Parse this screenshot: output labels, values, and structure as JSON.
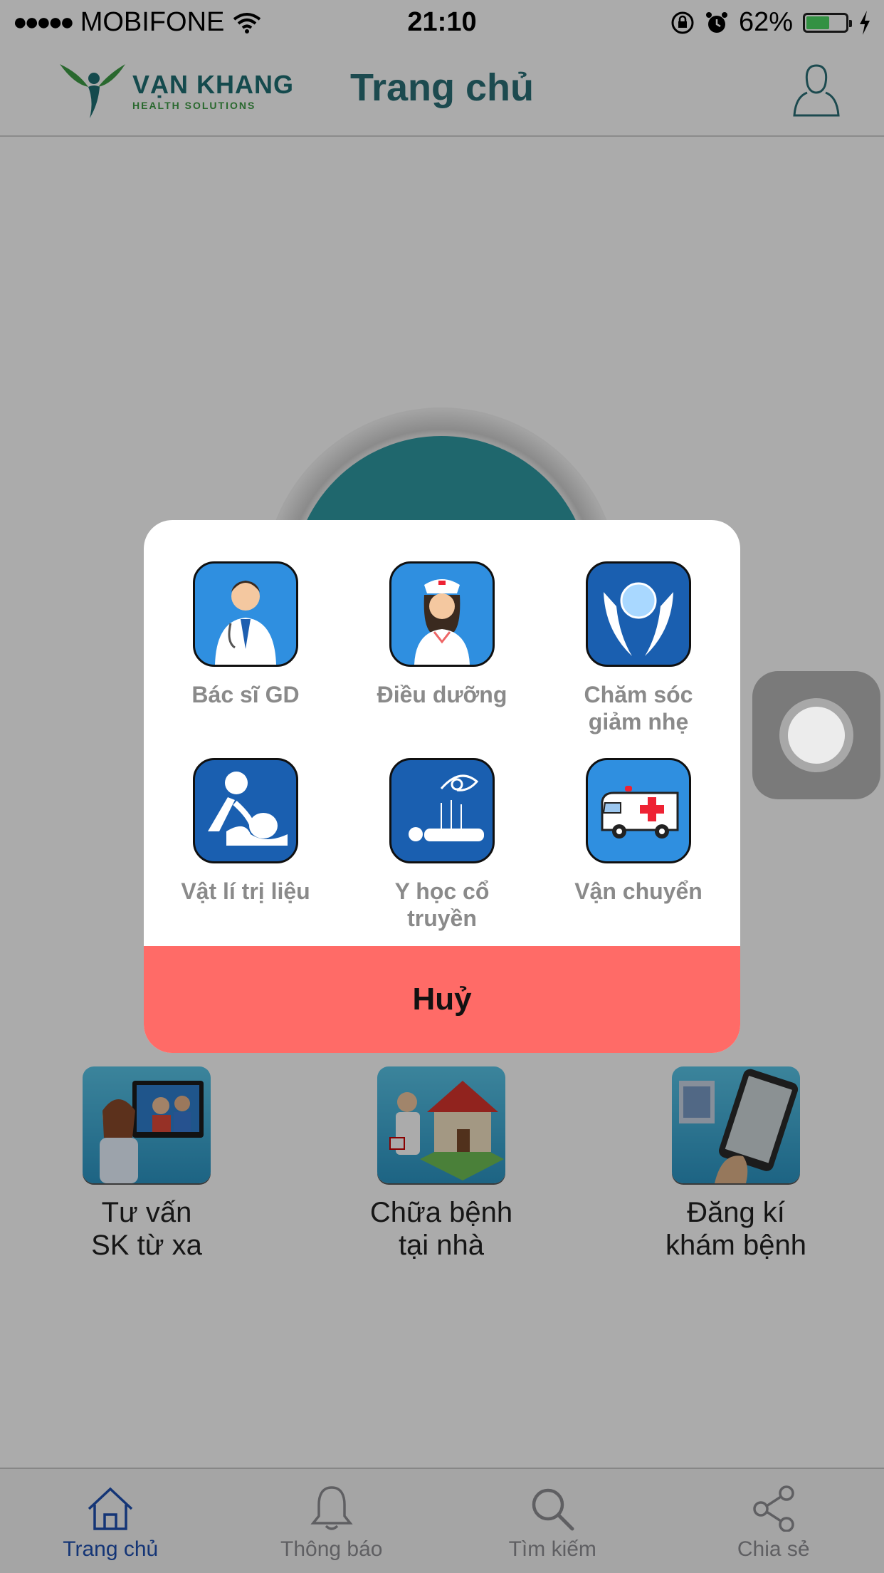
{
  "status_bar": {
    "carrier": "MOBIFONE",
    "time": "21:10",
    "battery_percent": "62%",
    "battery_level": 0.62
  },
  "nav": {
    "logo_name": "VẠN KHANG",
    "logo_sub": "HEALTH SOLUTIONS",
    "title": "Trang chủ"
  },
  "home_services": [
    {
      "line1": "Tư vấn",
      "line2": "SK từ xa"
    },
    {
      "line1": "Chữa bệnh",
      "line2": "tại nhà"
    },
    {
      "line1": "Đăng kí",
      "line2": "khám bệnh"
    }
  ],
  "modal": {
    "options": [
      {
        "line1": "Bác sĩ GD",
        "line2": ""
      },
      {
        "line1": "Điều dưỡng",
        "line2": ""
      },
      {
        "line1": "Chăm sóc",
        "line2": "giảm nhẹ"
      },
      {
        "line1": "Vật lí trị liệu",
        "line2": ""
      },
      {
        "line1": "Y học cổ",
        "line2": "truyền"
      },
      {
        "line1": "Vận chuyển",
        "line2": ""
      }
    ],
    "cancel_label": "Huỷ"
  },
  "tabs": [
    {
      "label": "Trang chủ",
      "icon": "home-icon",
      "active": true
    },
    {
      "label": "Thông báo",
      "icon": "bell-icon",
      "active": false
    },
    {
      "label": "Tìm kiếm",
      "icon": "search-icon",
      "active": false
    },
    {
      "label": "Chia sẻ",
      "icon": "share-icon",
      "active": false
    }
  ],
  "colors": {
    "brand_teal": "#2b6f76",
    "cancel_red": "#ff6b67",
    "active_tab": "#1e4fb0",
    "option_label": "#8a8a8a"
  }
}
